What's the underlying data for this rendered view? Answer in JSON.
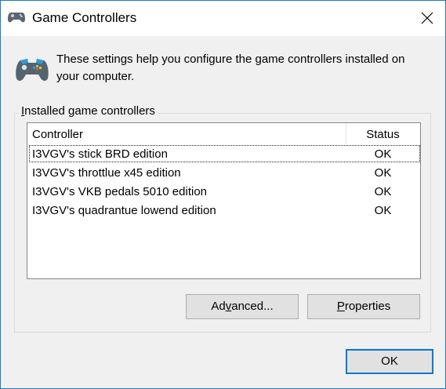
{
  "window": {
    "title": "Game Controllers",
    "icon": "gamepad-icon",
    "close_icon": "close-icon"
  },
  "description": {
    "line1": "These settings help you configure the game controllers installed on",
    "line2": "your computer."
  },
  "group": {
    "label_mnemonic": "I",
    "label_rest": "nstalled game controllers"
  },
  "list": {
    "columns": {
      "controller": "Controller",
      "status": "Status"
    },
    "rows": [
      {
        "name": "I3VGV's stick BRD edition",
        "status": "OK",
        "selected": true
      },
      {
        "name": "I3VGV's throttlue x45 edition",
        "status": "OK"
      },
      {
        "name": "I3VGV's VKB pedals 5010 edition",
        "status": "OK"
      },
      {
        "name": "I3VGV's quadrantue lowend edition",
        "status": "OK"
      }
    ]
  },
  "buttons": {
    "advanced_pre": "Ad",
    "advanced_mn": "v",
    "advanced_post": "anced...",
    "properties_mn": "P",
    "properties_post": "roperties",
    "ok": "OK"
  },
  "colors": {
    "accent": "#0078d7",
    "window_border": "#1979ca",
    "background": "#f0f0f0"
  }
}
